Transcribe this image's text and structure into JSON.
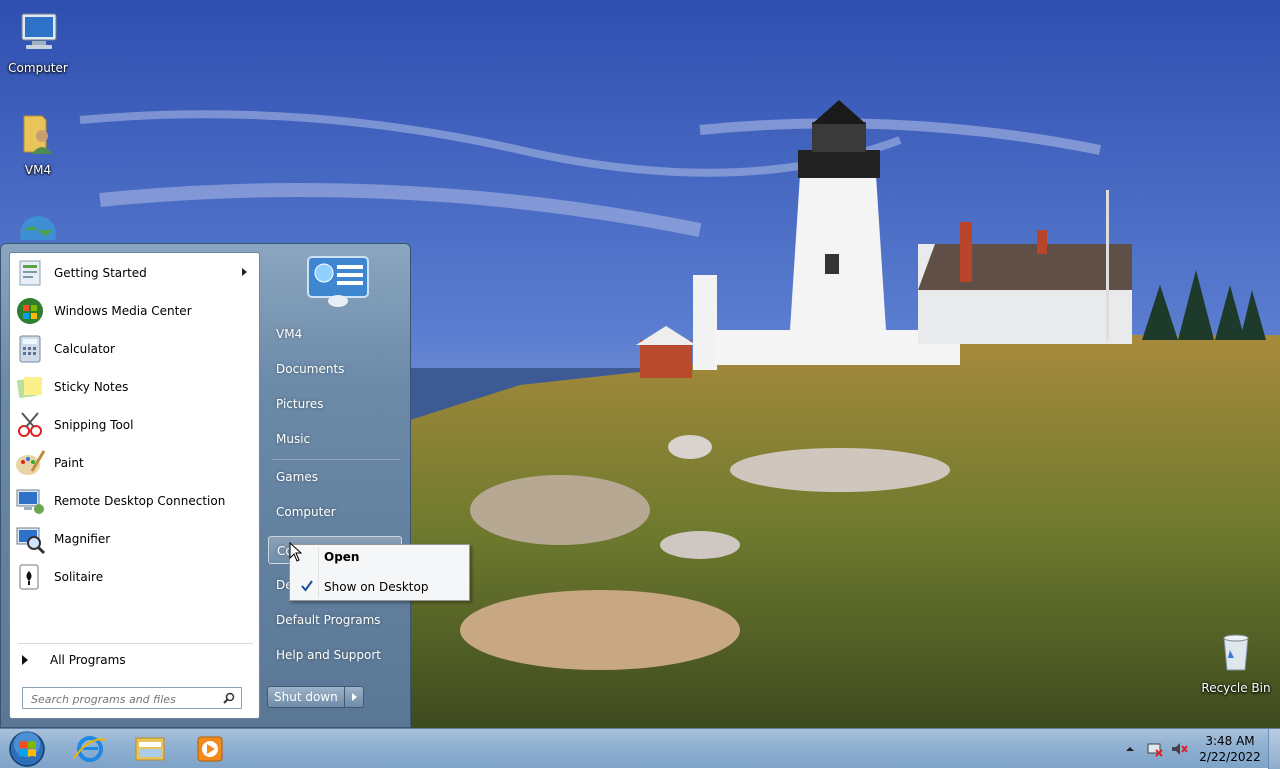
{
  "desktop": {
    "icons": [
      {
        "label": "Computer",
        "icon": "computer-icon"
      },
      {
        "label": "VM4",
        "icon": "user-folder-icon"
      },
      {
        "label": "Recycle Bin",
        "icon": "recycle-bin-icon"
      }
    ]
  },
  "start_menu": {
    "programs": [
      {
        "label": "Getting Started",
        "icon": "getting-started-icon",
        "has_submenu": true
      },
      {
        "label": "Windows Media Center",
        "icon": "media-center-icon"
      },
      {
        "label": "Calculator",
        "icon": "calculator-icon"
      },
      {
        "label": "Sticky Notes",
        "icon": "sticky-notes-icon"
      },
      {
        "label": "Snipping Tool",
        "icon": "snipping-tool-icon"
      },
      {
        "label": "Paint",
        "icon": "paint-icon"
      },
      {
        "label": "Remote Desktop Connection",
        "icon": "remote-desktop-icon"
      },
      {
        "label": "Magnifier",
        "icon": "magnifier-icon"
      },
      {
        "label": "Solitaire",
        "icon": "solitaire-icon"
      }
    ],
    "all_programs": "All Programs",
    "search_placeholder": "Search programs and files",
    "right_items": {
      "vm4": "VM4",
      "documents": "Documents",
      "pictures": "Pictures",
      "music": "Music",
      "games": "Games",
      "computer": "Computer",
      "control_panel": "Co",
      "devices": "De",
      "default_programs": "Default Programs",
      "help": "Help and Support"
    },
    "shutdown": "Shut down"
  },
  "context_menu": {
    "items": [
      {
        "label": "Open",
        "bold": true
      },
      {
        "label": "Show on Desktop",
        "checked": true
      }
    ]
  },
  "taskbar": {
    "clock_time": "3:48 AM",
    "clock_date": "2/22/2022"
  },
  "colors": {
    "taskbar": "#8fb0d1",
    "start_menu_right": "#6b8aa8",
    "sky": "#3f5fb8"
  }
}
